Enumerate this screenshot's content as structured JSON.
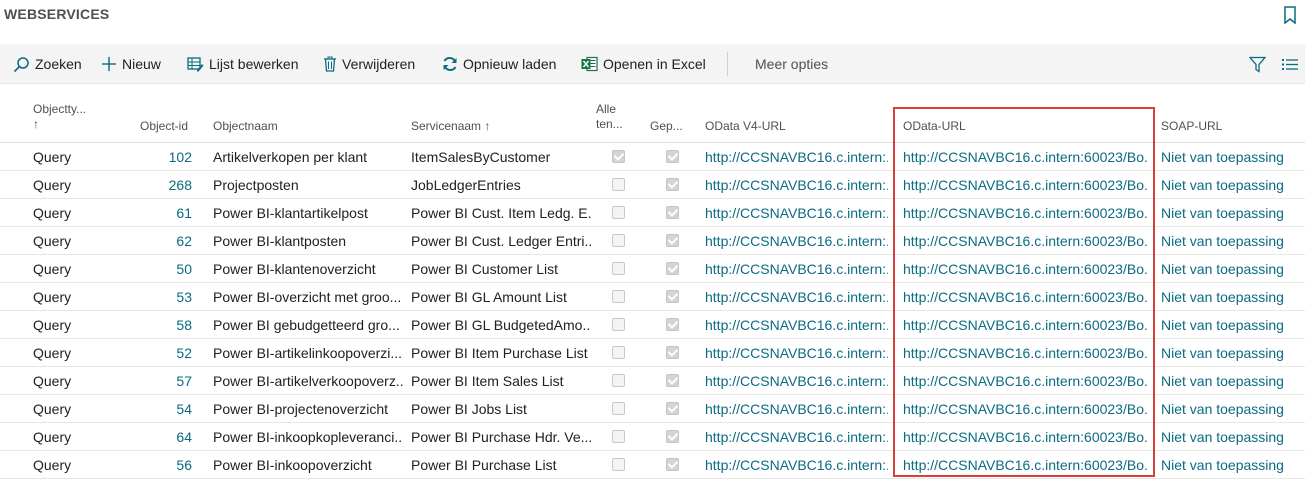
{
  "page": {
    "title": "WEBSERVICES"
  },
  "toolbar": {
    "search": "Zoeken",
    "new": "Nieuw",
    "edit_list": "Lijst bewerken",
    "delete": "Verwijderen",
    "reload": "Opnieuw laden",
    "excel": "Openen in Excel",
    "more": "Meer opties"
  },
  "columns": {
    "type_line1": "Objectty...",
    "type_line2": "↑",
    "id": "Object-id",
    "name": "Objectnaam",
    "service": "Servicenaam ↑",
    "all_line1": "Alle",
    "all_line2": "ten...",
    "published": "Gep...",
    "odata_v4": "OData V4-URL",
    "odata": "OData-URL",
    "soap": "SOAP-URL"
  },
  "rows": [
    {
      "type": "Query",
      "id": "102",
      "name": "Artikelverkopen per klant",
      "service": "ItemSalesByCustomer",
      "all_tenants": true,
      "published": true,
      "odata_v4": "http://CCSNAVBC16.c.intern:...",
      "odata": "http://CCSNAVBC16.c.intern:60023/Bo...",
      "soap": "Niet van toepassing"
    },
    {
      "type": "Query",
      "id": "268",
      "name": "Projectposten",
      "service": "JobLedgerEntries",
      "all_tenants": false,
      "published": true,
      "odata_v4": "http://CCSNAVBC16.c.intern:...",
      "odata": "http://CCSNAVBC16.c.intern:60023/Bo...",
      "soap": "Niet van toepassing"
    },
    {
      "type": "Query",
      "id": "61",
      "name": "Power BI-klantartikelpost",
      "service": "Power BI Cust. Item Ledg. E...",
      "all_tenants": false,
      "published": true,
      "odata_v4": "http://CCSNAVBC16.c.intern:...",
      "odata": "http://CCSNAVBC16.c.intern:60023/Bo...",
      "soap": "Niet van toepassing"
    },
    {
      "type": "Query",
      "id": "62",
      "name": "Power BI-klantposten",
      "service": "Power BI Cust. Ledger Entri...",
      "all_tenants": false,
      "published": true,
      "odata_v4": "http://CCSNAVBC16.c.intern:...",
      "odata": "http://CCSNAVBC16.c.intern:60023/Bo...",
      "soap": "Niet van toepassing"
    },
    {
      "type": "Query",
      "id": "50",
      "name": "Power BI-klantenoverzicht",
      "service": "Power BI Customer List",
      "all_tenants": false,
      "published": true,
      "odata_v4": "http://CCSNAVBC16.c.intern:...",
      "odata": "http://CCSNAVBC16.c.intern:60023/Bo...",
      "soap": "Niet van toepassing"
    },
    {
      "type": "Query",
      "id": "53",
      "name": "Power BI-overzicht met groo...",
      "service": "Power BI GL Amount List",
      "all_tenants": false,
      "published": true,
      "odata_v4": "http://CCSNAVBC16.c.intern:...",
      "odata": "http://CCSNAVBC16.c.intern:60023/Bo...",
      "soap": "Niet van toepassing"
    },
    {
      "type": "Query",
      "id": "58",
      "name": "Power BI gebudgetteerd gro...",
      "service": "Power BI GL BudgetedAmo...",
      "all_tenants": false,
      "published": true,
      "odata_v4": "http://CCSNAVBC16.c.intern:...",
      "odata": "http://CCSNAVBC16.c.intern:60023/Bo...",
      "soap": "Niet van toepassing"
    },
    {
      "type": "Query",
      "id": "52",
      "name": "Power BI-artikelinkoopoverzi...",
      "service": "Power BI Item Purchase List",
      "all_tenants": false,
      "published": true,
      "odata_v4": "http://CCSNAVBC16.c.intern:...",
      "odata": "http://CCSNAVBC16.c.intern:60023/Bo...",
      "soap": "Niet van toepassing"
    },
    {
      "type": "Query",
      "id": "57",
      "name": "Power BI-artikelverkoopoverz...",
      "service": "Power BI Item Sales List",
      "all_tenants": false,
      "published": true,
      "odata_v4": "http://CCSNAVBC16.c.intern:...",
      "odata": "http://CCSNAVBC16.c.intern:60023/Bo...",
      "soap": "Niet van toepassing"
    },
    {
      "type": "Query",
      "id": "54",
      "name": "Power BI-projectenoverzicht",
      "service": "Power BI Jobs List",
      "all_tenants": false,
      "published": true,
      "odata_v4": "http://CCSNAVBC16.c.intern:...",
      "odata": "http://CCSNAVBC16.c.intern:60023/Bo...",
      "soap": "Niet van toepassing"
    },
    {
      "type": "Query",
      "id": "64",
      "name": "Power BI-inkoopkopleveranci...",
      "service": "Power BI Purchase Hdr. Ve...",
      "all_tenants": false,
      "published": true,
      "odata_v4": "http://CCSNAVBC16.c.intern:...",
      "odata": "http://CCSNAVBC16.c.intern:60023/Bo...",
      "soap": "Niet van toepassing"
    },
    {
      "type": "Query",
      "id": "56",
      "name": "Power BI-inkoopoverzicht",
      "service": "Power BI Purchase List",
      "all_tenants": false,
      "published": true,
      "odata_v4": "http://CCSNAVBC16.c.intern:...",
      "odata": "http://CCSNAVBC16.c.intern:60023/Bo...",
      "soap": "Niet van toepassing"
    }
  ],
  "colors": {
    "link": "#0a6b81",
    "highlight": "#d9403c",
    "excel": "#1e7145"
  }
}
